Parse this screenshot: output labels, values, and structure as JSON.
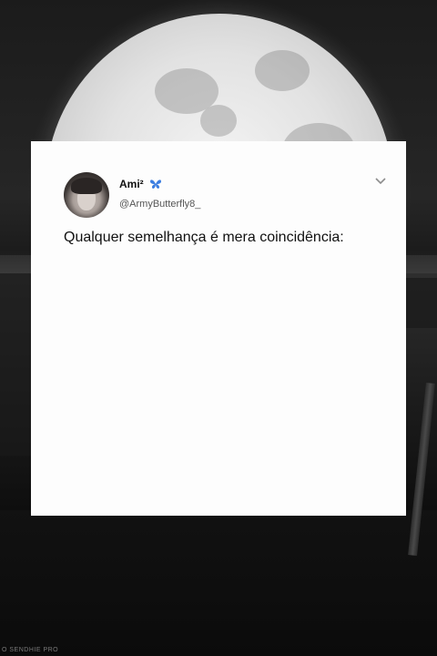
{
  "tweet": {
    "display_name": "Ami²",
    "emoji_icon": "butterfly-icon",
    "handle": "@ArmyButterfly8_",
    "text": "Qualquer semelhança é mera coincidência:",
    "menu_icon": "chevron-down-icon"
  },
  "watermark": "O SENDHIE PRO",
  "colors": {
    "card_background": "#fdfdfd",
    "text_primary": "#111111",
    "text_secondary": "#555555",
    "butterfly_blue": "#3b7de0",
    "chevron": "#8c8c8c"
  }
}
